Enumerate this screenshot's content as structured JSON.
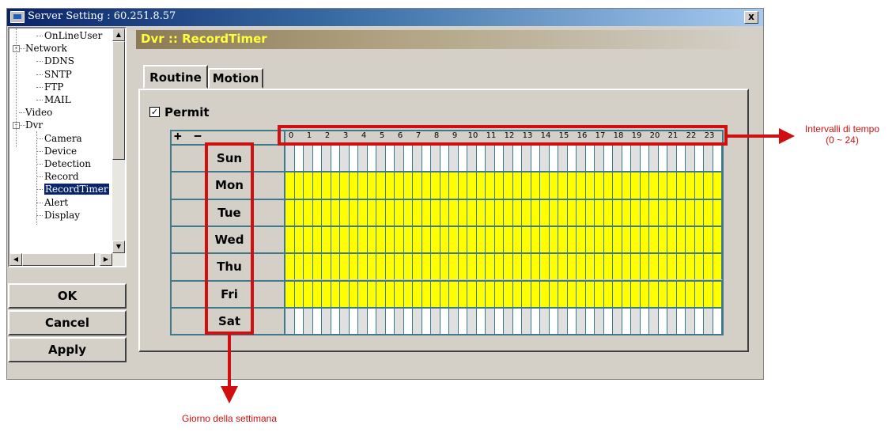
{
  "window": {
    "title": "Server Setting : 60.251.8.57",
    "close_label": "x"
  },
  "tree": {
    "items": [
      {
        "label": "OnLineUser",
        "indent": 2,
        "selected": false
      },
      {
        "label": "Network",
        "indent": 1,
        "expander": "-",
        "selected": false
      },
      {
        "label": "DDNS",
        "indent": 2,
        "selected": false
      },
      {
        "label": "SNTP",
        "indent": 2,
        "selected": false
      },
      {
        "label": "FTP",
        "indent": 2,
        "selected": false
      },
      {
        "label": "MAIL",
        "indent": 2,
        "selected": false
      },
      {
        "label": "Video",
        "indent": 1,
        "selected": false
      },
      {
        "label": "Dvr",
        "indent": 1,
        "expander": "-",
        "selected": false
      },
      {
        "label": "Camera",
        "indent": 2,
        "selected": false
      },
      {
        "label": "Device",
        "indent": 2,
        "selected": false
      },
      {
        "label": "Detection",
        "indent": 2,
        "selected": false
      },
      {
        "label": "Record",
        "indent": 2,
        "selected": false
      },
      {
        "label": "RecordTimer",
        "indent": 2,
        "selected": true
      },
      {
        "label": "Alert",
        "indent": 2,
        "selected": false
      },
      {
        "label": "Display",
        "indent": 2,
        "selected": false
      }
    ]
  },
  "buttons": {
    "ok": "OK",
    "cancel": "Cancel",
    "apply": "Apply"
  },
  "panel": {
    "header": "Dvr :: RecordTimer"
  },
  "tabs": [
    {
      "label": "Routine",
      "active": true
    },
    {
      "label": "Motion",
      "active": false
    }
  ],
  "permit": {
    "label": "Permit",
    "checked": true,
    "check_mark": "✓"
  },
  "grid": {
    "plus_label": "+",
    "minus_label": "−",
    "hours": [
      "0",
      "1",
      "2",
      "3",
      "4",
      "5",
      "6",
      "7",
      "8",
      "9",
      "10",
      "11",
      "12",
      "13",
      "14",
      "15",
      "16",
      "17",
      "18",
      "19",
      "20",
      "21",
      "22",
      "23"
    ],
    "days": [
      {
        "label": "Sun",
        "pattern": "empty"
      },
      {
        "label": "Mon",
        "pattern": "full"
      },
      {
        "label": "Tue",
        "pattern": "full"
      },
      {
        "label": "Wed",
        "pattern": "full"
      },
      {
        "label": "Thu",
        "pattern": "full"
      },
      {
        "label": "Fri",
        "pattern": "full"
      },
      {
        "label": "Sat",
        "pattern": "empty"
      }
    ],
    "colors": {
      "recording": "#ffff00",
      "empty_a": "#ffffff",
      "empty_b": "#e0e0e0",
      "grid_line": "#3f7a8a"
    }
  },
  "annotations": {
    "time_intervals": {
      "line1": "Intervalli di tempo",
      "line2": "(0 ~ 24)"
    },
    "weekday": "Giorno della settimana",
    "color": "#d01010"
  }
}
